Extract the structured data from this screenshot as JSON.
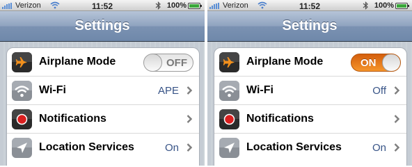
{
  "colors": {
    "toggle_on": "#f07f1f",
    "value_text": "#385487",
    "navbar": "#7b92b2"
  },
  "screens": [
    {
      "status": {
        "carrier": "Verizon",
        "time": "11:52",
        "battery": "100%"
      },
      "title": "Settings",
      "rows": [
        {
          "label": "Airplane Mode",
          "toggle": "OFF",
          "icon": "airplane-icon"
        },
        {
          "label": "Wi-Fi",
          "value": "APE",
          "icon": "wifi-icon"
        },
        {
          "label": "Notifications",
          "value": "",
          "icon": "notifications-icon"
        },
        {
          "label": "Location Services",
          "value": "On",
          "icon": "location-arrow-icon"
        }
      ]
    },
    {
      "status": {
        "carrier": "Verizon",
        "time": "11:52",
        "battery": "100%"
      },
      "title": "Settings",
      "rows": [
        {
          "label": "Airplane Mode",
          "toggle": "ON",
          "icon": "airplane-icon"
        },
        {
          "label": "Wi-Fi",
          "value": "Off",
          "icon": "wifi-icon"
        },
        {
          "label": "Notifications",
          "value": "",
          "icon": "notifications-icon"
        },
        {
          "label": "Location Services",
          "value": "On",
          "icon": "location-arrow-icon"
        }
      ]
    }
  ]
}
